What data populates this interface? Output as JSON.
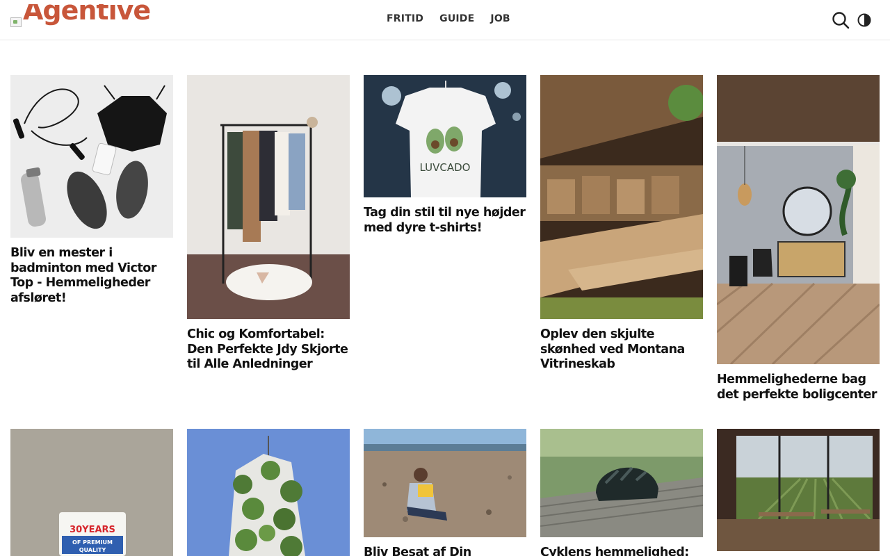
{
  "header": {
    "logo_text": "Agentive",
    "nav": [
      "FRITID",
      "GUIDE",
      "JOB"
    ],
    "icons": {
      "search": "search-icon",
      "theme": "dark-mode-toggle-icon"
    }
  },
  "colors": {
    "brand": "#c8563a",
    "text": "#111111",
    "nav": "#333333"
  },
  "articles": [
    {
      "title": "Bliv en mester i badminton med Victor Top - Hemmeligheder afsløret!"
    },
    {
      "title": "Chic og Komfortabel: Den Perfekte Jdy Skjorte til Alle Anledninger"
    },
    {
      "title": "Tag din stil til nye højder med dyre t-shirts!"
    },
    {
      "title": "Oplev den skjulte skønhed ved Montana Vitrineskab"
    },
    {
      "title": "Hemmelighederne bag det perfekte boligcenter"
    },
    {
      "title": ""
    },
    {
      "title": ""
    },
    {
      "title": "Bliv Besat af Din Passion:"
    },
    {
      "title": "Cyklens hemmelighed:"
    },
    {
      "title": ""
    }
  ],
  "image_text": {
    "quality_sign": "30YEARS OF PREMIUM QUALITY",
    "tshirt_print": "LUVCADO"
  }
}
